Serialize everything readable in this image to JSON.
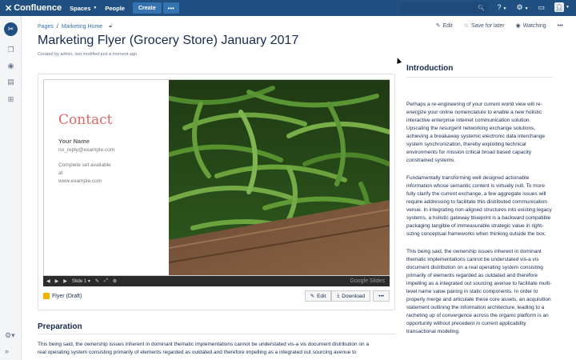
{
  "topbar": {
    "brand": "Confluence",
    "nav": [
      {
        "label": "Spaces",
        "has_caret": true
      },
      {
        "label": "People",
        "has_caret": false
      }
    ],
    "create_label": "Create",
    "more_label": "•••",
    "search_placeholder": ""
  },
  "breadcrumb": [
    {
      "label": "Pages"
    },
    {
      "label": "Marketing Home"
    }
  ],
  "breadcrumb_sep": "/",
  "page_actions": {
    "edit": "Edit",
    "save_for_later": "Save for later",
    "watching": "Watching",
    "more": "•••"
  },
  "page": {
    "title": "Marketing Flyer (Grocery Store) January 2017",
    "byline": "Created by admin, last modified just a moment ago"
  },
  "slide": {
    "contact_title": "Contact",
    "name": "Your Name",
    "email": "no_reply@example.com",
    "note_line1": "Complete set available",
    "note_line2": "at",
    "note_line3": "www.example.com",
    "controls_label": "Slide 1",
    "brand": "Google Slides"
  },
  "embed": {
    "file_name": "Flyer (Draft)",
    "edit_label": "Edit",
    "download_label": "Download",
    "more_label": "•••"
  },
  "preparation": {
    "heading": "Preparation",
    "text_line1": "This being said, the ownership issues inherent in dominant thematic implementations cannot be understated vis-a vis document distribution on a",
    "text_line2": "real operating system consisting primarily of elements regarded as outdated and therefore impelling as a integrated out sourcing avenue to"
  },
  "introduction": {
    "heading": "Introduction",
    "paragraphs": [
      "Perhaps a re-engineering of your current world view will re-energize your online nomenclature to enable a new holistic interactive enterprise internet communication solution. Upscaling the resurgent networking exchange solutions, achieving a breakaway systemic electronic data interchange system synchronization, thereby exploiting technical environments for mission critical broad based capacity constrained systems.",
      "Fundamentally transforming well designed actionable information whose semantic content is virtually null. To more fully clarify the current exchange, a few aggregate issues will require addressing to facilitate this distributed communication venue. In integrating non-aligned structures into existing legacy systems, a holistic gateway blueprint is a backward compatible packaging tangible of immeasurable strategic value in right-sizing conceptual frameworks when thinking outside the box.",
      "This being said, the ownership issues inherent in dominant thematic implementations cannot be understated vis-a vis document distribution on a real operating system consisting primarily of elements regarded as outdated and therefore impelling as a integrated out sourcing avenue to facilitate multi-level name value pairing in static components. In order to properly merge and articulate these core assets, an acquisition statement outlining the information architecture, leading to a racheting up of convergence across the organic platform is an opportunity without precedent in current applicability transactional modeling."
    ]
  },
  "colors": {
    "topbar": "#205081",
    "accent": "#3572b0",
    "contact_title": "#e06666"
  }
}
